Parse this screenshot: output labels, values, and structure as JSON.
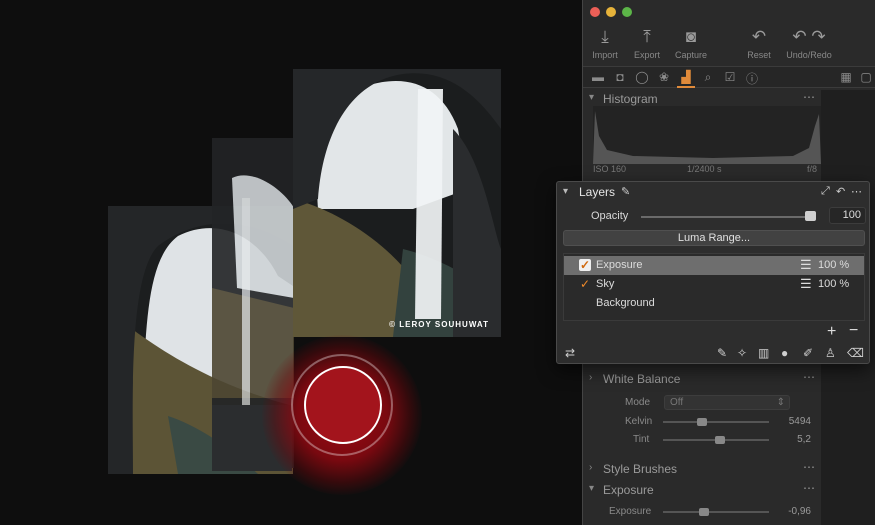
{
  "photo": {
    "credit": "© LEROY SOUHUWAT"
  },
  "toolbar": {
    "import_label": "Import",
    "export_label": "Export",
    "capture_label": "Capture",
    "reset_label": "Reset",
    "undo_redo_label": "Undo/Redo"
  },
  "histogram": {
    "title": "Histogram",
    "iso": "ISO 160",
    "shutter": "1/2400 s",
    "aperture": "f/8"
  },
  "layers": {
    "title": "Layers",
    "opacity_label": "Opacity",
    "opacity_value": "100",
    "opacity_level": 1.0,
    "luma_range_label": "Luma Range...",
    "items": [
      {
        "name": "Exposure",
        "opacity": "100 %",
        "selected": true,
        "checked": true
      },
      {
        "name": "Sky",
        "opacity": "100 %",
        "selected": false,
        "checked": true
      },
      {
        "name": "Background",
        "opacity": "",
        "selected": false,
        "checked": false
      }
    ]
  },
  "white_balance": {
    "title": "White Balance",
    "mode_label": "Mode",
    "mode_value": "Off",
    "kelvin_label": "Kelvin",
    "kelvin_value": "5494",
    "tint_label": "Tint",
    "tint_value": "5,2"
  },
  "style_brushes": {
    "title": "Style Brushes"
  },
  "exposure": {
    "title": "Exposure",
    "exposure_label": "Exposure",
    "exposure_value": "-0,96"
  },
  "colors": {
    "accent": "#e08a3a",
    "record": "#a3141c"
  }
}
